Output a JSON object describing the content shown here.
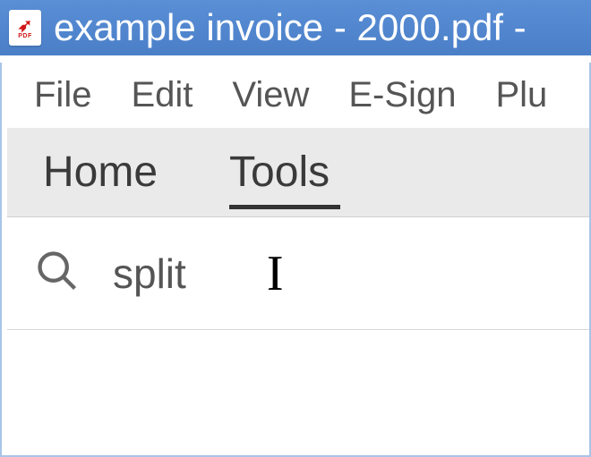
{
  "window": {
    "title": "example invoice - 2000.pdf -",
    "icon": {
      "symbol": "⚡",
      "label": "PDF"
    }
  },
  "menubar": {
    "items": [
      {
        "label": "File"
      },
      {
        "label": "Edit"
      },
      {
        "label": "View"
      },
      {
        "label": "E-Sign"
      },
      {
        "label": "Plu"
      }
    ]
  },
  "tabs": {
    "items": [
      {
        "label": "Home",
        "active": false
      },
      {
        "label": "Tools",
        "active": true
      }
    ]
  },
  "search": {
    "value": "split",
    "placeholder": ""
  }
}
